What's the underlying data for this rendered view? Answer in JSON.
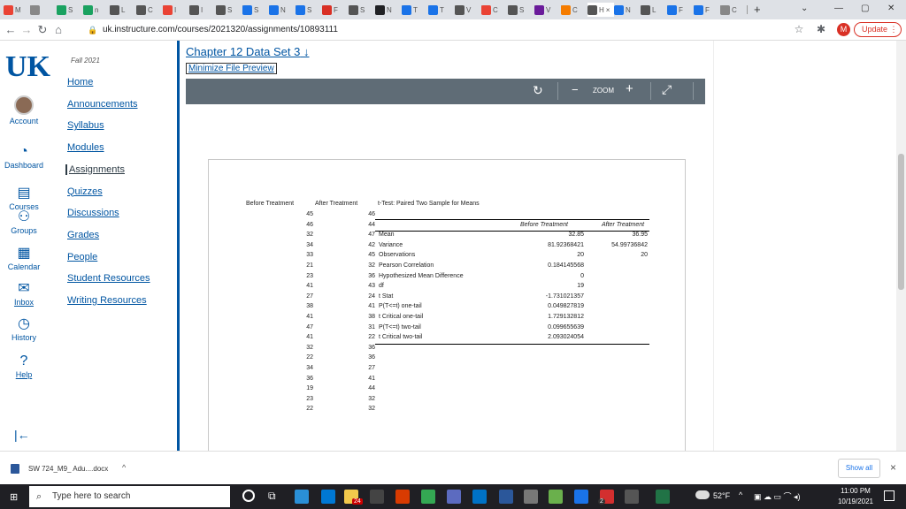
{
  "browser": {
    "tabs": [
      {
        "letter": "M",
        "color": "#ea4335"
      },
      {
        "letter": "",
        "color": "#888"
      },
      {
        "letter": "S",
        "color": "#1aa260"
      },
      {
        "letter": "n",
        "color": "#1aa260"
      },
      {
        "letter": "L",
        "color": "#555"
      },
      {
        "letter": "C",
        "color": "#555"
      },
      {
        "letter": "I",
        "color": "#ea4335"
      },
      {
        "letter": "I",
        "color": "#555"
      },
      {
        "letter": "S",
        "color": "#555"
      },
      {
        "letter": "S",
        "color": "#1a73e8"
      },
      {
        "letter": "N",
        "color": "#1a73e8"
      },
      {
        "letter": "S",
        "color": "#1a73e8"
      },
      {
        "letter": "F",
        "color": "#d93025"
      },
      {
        "letter": "S",
        "color": "#555"
      },
      {
        "letter": "N",
        "color": "#202124"
      },
      {
        "letter": "T",
        "color": "#1a73e8"
      },
      {
        "letter": "T",
        "color": "#1a73e8"
      },
      {
        "letter": "V",
        "color": "#555"
      },
      {
        "letter": "C",
        "color": "#ea4335"
      },
      {
        "letter": "S",
        "color": "#555"
      },
      {
        "letter": "V",
        "color": "#6a1b9a"
      },
      {
        "letter": "C",
        "color": "#f57c00"
      },
      {
        "letter": "H",
        "color": "#555"
      },
      {
        "letter": "N",
        "color": "#1a73e8"
      },
      {
        "letter": "L",
        "color": "#555"
      },
      {
        "letter": "F",
        "color": "#1a73e8"
      },
      {
        "letter": "F",
        "color": "#1a73e8"
      },
      {
        "letter": "C",
        "color": "#888"
      }
    ],
    "active_tab_close": "×",
    "new_tab": "+",
    "url": "uk.instructure.com/courses/2021320/assignments/10893111",
    "profile_letter": "M",
    "update_label": "Update"
  },
  "global_nav": [
    {
      "label": "Account",
      "icon": "account-icon"
    },
    {
      "label": "Dashboard",
      "icon": "dashboard-icon"
    },
    {
      "label": "Courses",
      "icon": "courses-icon"
    },
    {
      "label": "Groups",
      "icon": "groups-icon"
    },
    {
      "label": "Calendar",
      "icon": "calendar-icon"
    },
    {
      "label": "Inbox",
      "icon": "inbox-icon"
    },
    {
      "label": "History",
      "icon": "history-icon"
    },
    {
      "label": "Help",
      "icon": "help-icon"
    }
  ],
  "logo_text": "UK",
  "course_nav": {
    "term": "Fall 2021",
    "items": [
      "Home",
      "Announcements",
      "Syllabus",
      "Modules",
      "Assignments",
      "Quizzes",
      "Discussions",
      "Grades",
      "People",
      "Student Resources",
      "Writing Resources"
    ],
    "active": "Assignments"
  },
  "file": {
    "title": "Chapter 12 Data Set 3",
    "download_icon": "↓",
    "minimize_label": "Minimize File Preview",
    "zoom_label": "ZOOM",
    "zoom_minus": "−",
    "zoom_plus": "+"
  },
  "spreadsheet": {
    "col_before": "Before Treatment",
    "col_after": "After Treatment",
    "before": [
      "45",
      "46",
      "32",
      "34",
      "33",
      "21",
      "23",
      "41",
      "27",
      "38",
      "41",
      "47",
      "41",
      "32",
      "22",
      "34",
      "36",
      "19",
      "23",
      "22"
    ],
    "after": [
      "46",
      "44",
      "47",
      "42",
      "45",
      "32",
      "36",
      "43",
      "24",
      "41",
      "38",
      "31",
      "22",
      "36",
      "36",
      "27",
      "41",
      "44",
      "32",
      "32"
    ],
    "ttest_title": "t-Test: Paired Two Sample for Means",
    "ttest_header": [
      "Before Treatment",
      "After Treatment"
    ],
    "ttest_rows": [
      {
        "label": "Mean",
        "before": "32.85",
        "after": "36.95"
      },
      {
        "label": "Variance",
        "before": "81.92368421",
        "after": "54.99736842"
      },
      {
        "label": "Observations",
        "before": "20",
        "after": "20"
      },
      {
        "label": "Pearson Correlation",
        "before": "0.184145568",
        "after": ""
      },
      {
        "label": "Hypothesized Mean Difference",
        "before": "0",
        "after": ""
      },
      {
        "label": "df",
        "before": "19",
        "after": ""
      },
      {
        "label": "t Stat",
        "before": "-1.731021357",
        "after": ""
      },
      {
        "label": "P(T<=t) one-tail",
        "before": "0.049827819",
        "after": ""
      },
      {
        "label": "t Critical one-tail",
        "before": "1.729132812",
        "after": ""
      },
      {
        "label": "P(T<=t) two-tail",
        "before": "0.099655639",
        "after": ""
      },
      {
        "label": "t Critical two-tail",
        "before": "2.093024054",
        "after": ""
      }
    ]
  },
  "download_bar": {
    "file_name": "SW 724_M9_ Adu....docx",
    "show_all": "Show all",
    "close": "×"
  },
  "taskbar": {
    "search_placeholder": "Type here to search",
    "weather": "52°F",
    "time": "11:00 PM",
    "date": "10/19/2021",
    "badge_24": "24",
    "badge_2": "2"
  }
}
